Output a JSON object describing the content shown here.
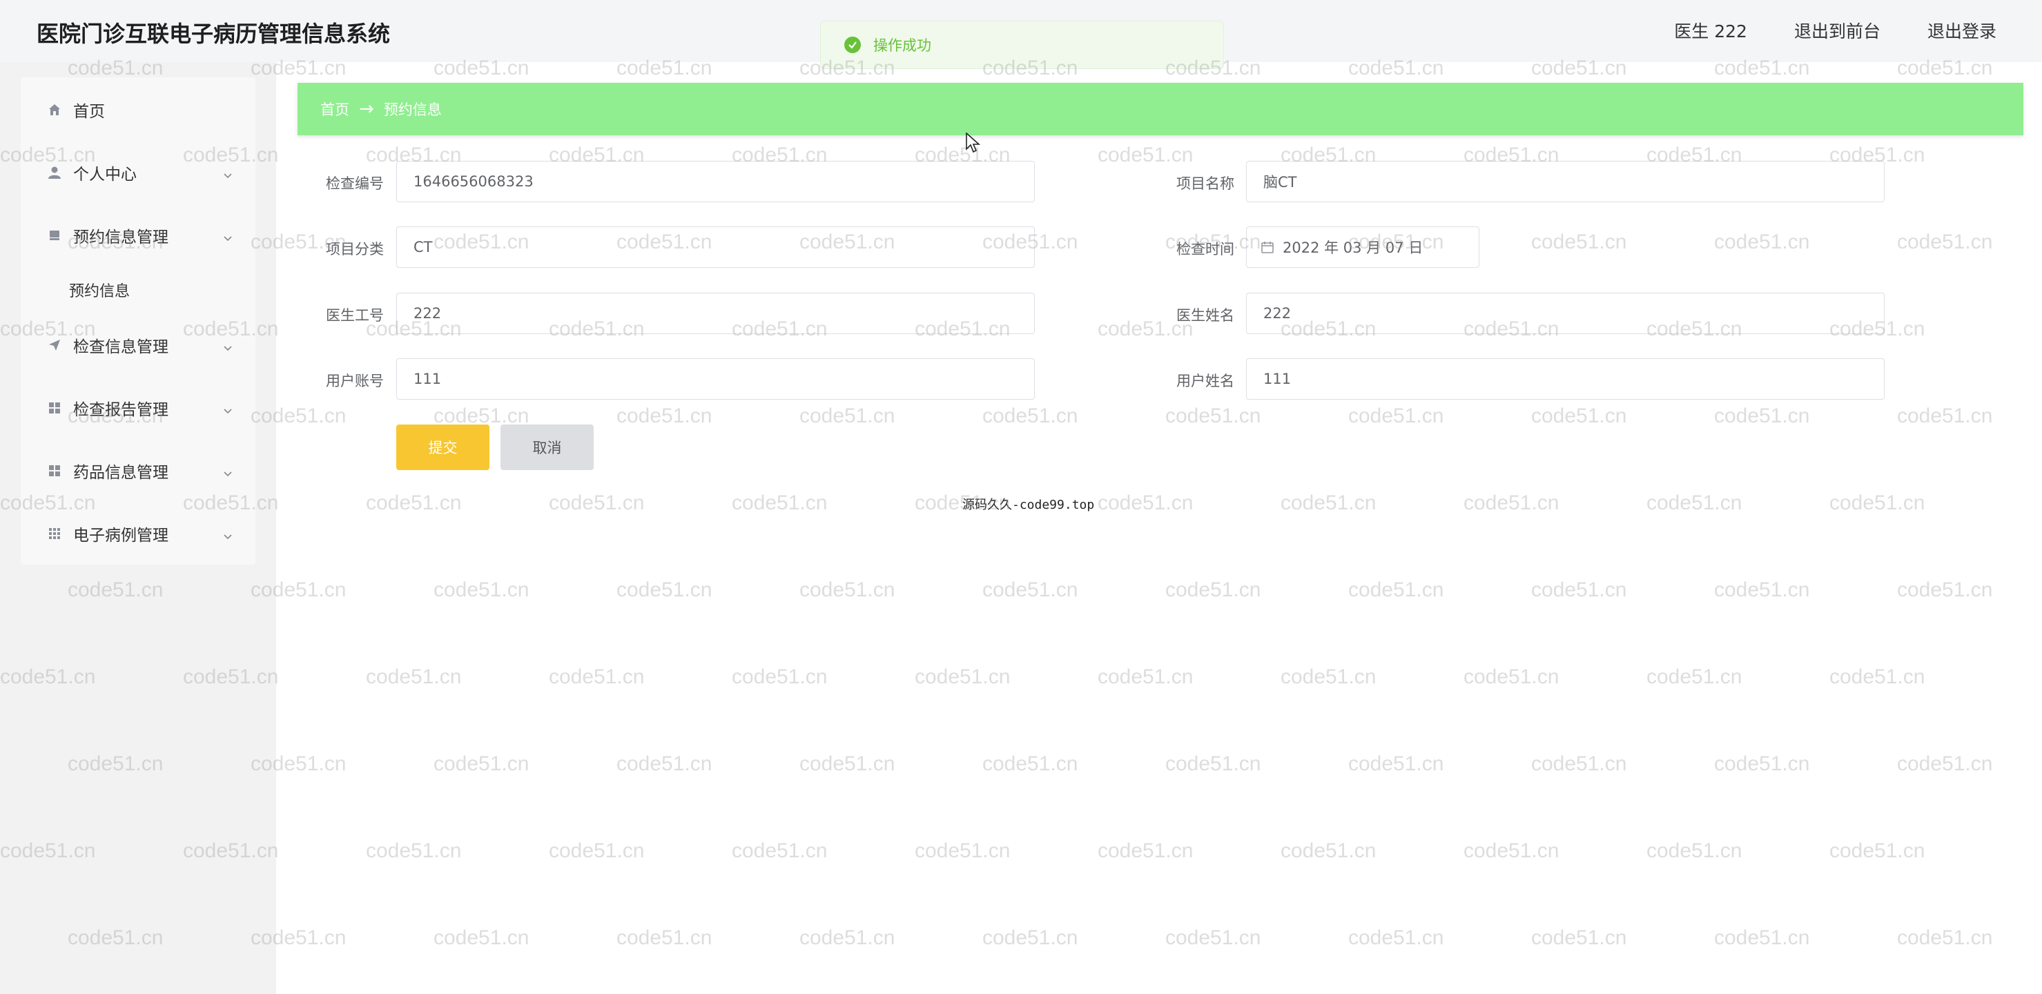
{
  "header": {
    "title": "医院门诊互联电子病历管理信息系统",
    "user_label": "医生 222",
    "back_to_front_label": "退出到前台",
    "logout_label": "退出登录"
  },
  "toast": {
    "message": "操作成功",
    "icon": "success-check-icon",
    "color": "#67c23a"
  },
  "sidebar": {
    "items": [
      {
        "label": "首页",
        "icon": "home-icon"
      },
      {
        "label": "个人中心",
        "icon": "user-icon"
      },
      {
        "label": "预约信息管理",
        "icon": "bookmark-icon"
      },
      {
        "label": "预约信息"
      },
      {
        "label": "检查信息管理",
        "icon": "send-icon"
      },
      {
        "label": "检查报告管理",
        "icon": "grid-icon"
      },
      {
        "label": "药品信息管理",
        "icon": "grid-icon"
      },
      {
        "label": "电子病例管理",
        "icon": "apps-icon"
      }
    ]
  },
  "breadcrumb": {
    "home": "首页",
    "separator": "→",
    "current": "预约信息",
    "bg_color": "#90ee90"
  },
  "form": {
    "fields": [
      {
        "label": "检查编号",
        "value": "1646656068323"
      },
      {
        "label": "项目名称",
        "value": "脑CT"
      },
      {
        "label": "项目分类",
        "value": "CT"
      },
      {
        "label": "检查时间",
        "value": "2022 年 03 月 07 日"
      },
      {
        "label": "医生工号",
        "value": "222"
      },
      {
        "label": "医生姓名",
        "value": "222"
      },
      {
        "label": "用户账号",
        "value": "111"
      },
      {
        "label": "用户姓名",
        "value": "111"
      }
    ],
    "submit_label": "提交",
    "cancel_label": "取消",
    "submit_color": "#f7c630"
  },
  "footer_note": "源码久久-code99.top",
  "watermark": "code51.cn"
}
